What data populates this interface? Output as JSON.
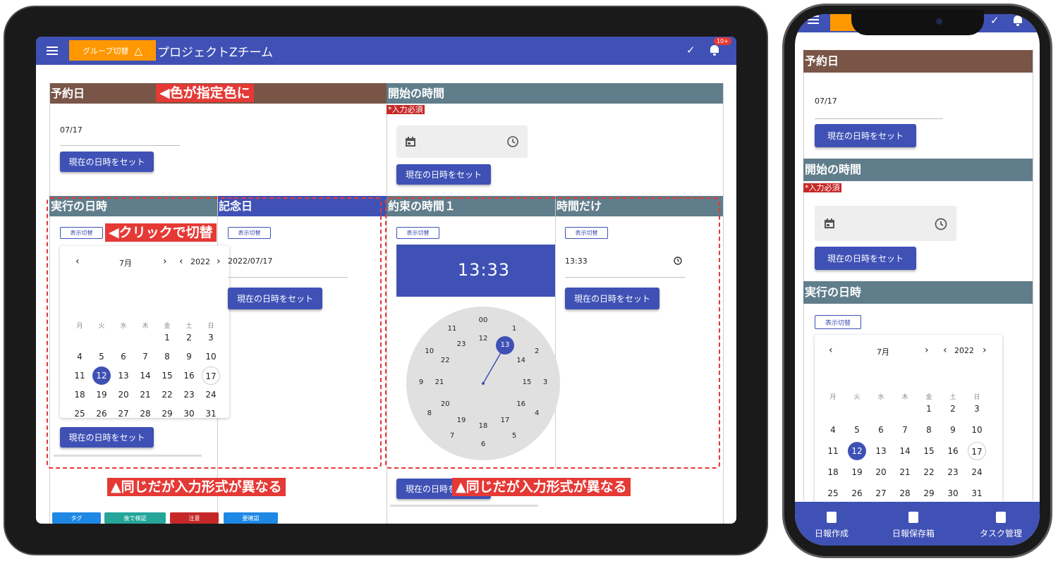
{
  "app": {
    "title": "プロジェクトZチーム",
    "group_switch": "グループ切替",
    "warning_icon": "△",
    "check_icon": "✓",
    "badge": "10+"
  },
  "sections": {
    "reserve_date": {
      "title": "予約日",
      "value": "07/17",
      "button": "現在の日時をセット"
    },
    "start_time": {
      "title": "開始の時間",
      "required": "*入力必須",
      "button": "現在の日時をセット"
    },
    "exec_datetime": {
      "title": "実行の日時",
      "toggle": "表示切替",
      "button": "現在の日時をセット"
    },
    "anniversary": {
      "title": "記念日",
      "toggle": "表示切替",
      "value": "2022/07/17",
      "button": "現在の日時をセット"
    },
    "promise_time": {
      "title": "約束の時間１",
      "toggle": "表示切替",
      "clock_time": "13:33",
      "button": "現在の日時をセット"
    },
    "time_only": {
      "title": "時間だけ",
      "toggle": "表示切替",
      "value": "13:33",
      "button": "現在の日時をセット"
    }
  },
  "calendar": {
    "month": "7月",
    "year": "2022",
    "prev": "‹",
    "next": "›",
    "weekdays": [
      "月",
      "火",
      "水",
      "木",
      "金",
      "土",
      "日"
    ],
    "rows": [
      [
        "",
        "",
        "",
        "",
        "1",
        "2",
        "3"
      ],
      [
        "4",
        "5",
        "6",
        "7",
        "8",
        "9",
        "10"
      ],
      [
        "11",
        "12",
        "13",
        "14",
        "15",
        "16",
        "17"
      ],
      [
        "18",
        "19",
        "20",
        "21",
        "22",
        "23",
        "24"
      ],
      [
        "25",
        "26",
        "27",
        "28",
        "29",
        "30",
        "31"
      ]
    ],
    "selected": "12",
    "today": "17"
  },
  "clock": {
    "outer": [
      "00",
      "1",
      "2",
      "3",
      "4",
      "5",
      "6",
      "7",
      "8",
      "9",
      "10",
      "11"
    ],
    "inner": [
      "12",
      "13",
      "14",
      "15",
      "16",
      "17",
      "18",
      "19",
      "20",
      "21",
      "22",
      "23"
    ],
    "selected": "13"
  },
  "annotations": {
    "color_note": "◀色が指定色に",
    "click_note": "◀クリックで切替",
    "same_note_left": "▲同じだが入力形式が異なる",
    "same_note_right": "▲同じだが入力形式が異なる"
  },
  "tags": [
    "タグ",
    "後で検証",
    "注意",
    "要確認"
  ],
  "bottom_nav": [
    "日報作成",
    "日報保存箱",
    "タスク管理"
  ],
  "colors": {
    "primary": "#3f51b5",
    "brown": "#795548",
    "slate": "#607d8b",
    "orange": "#ff9800",
    "annotation": "#e53935"
  }
}
